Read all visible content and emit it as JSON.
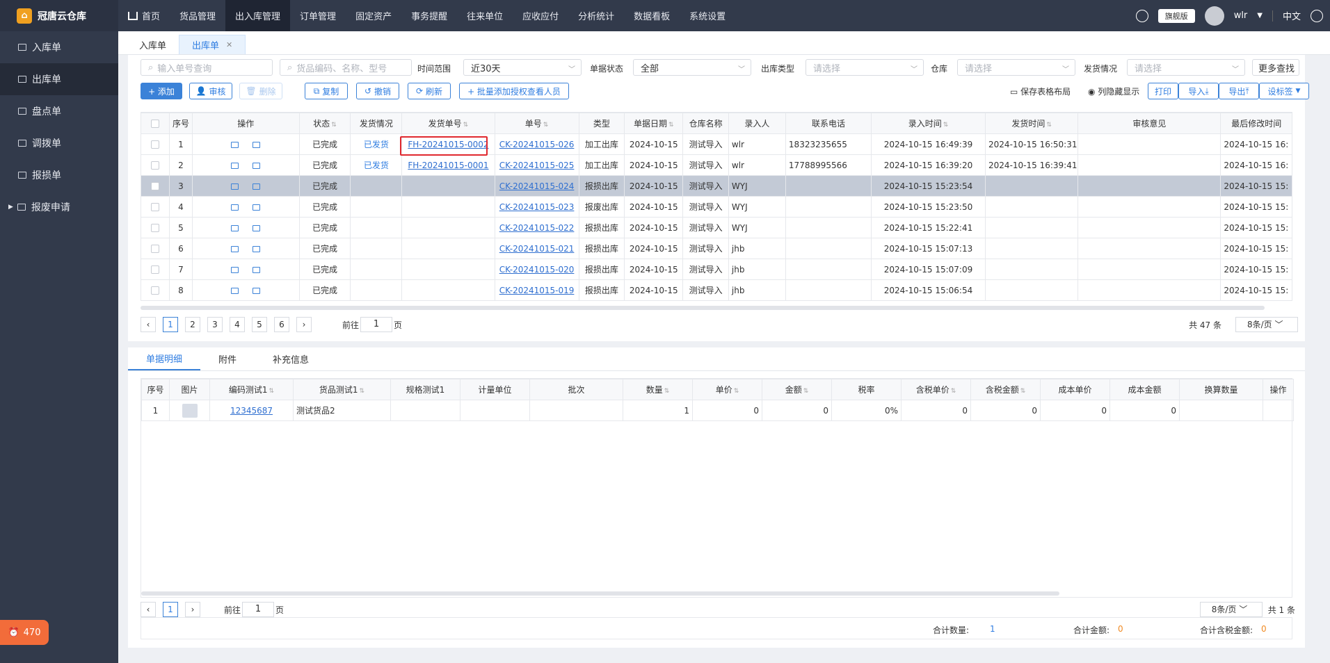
{
  "app": {
    "name": "冠唐云仓库",
    "version_badge": "旗舰版",
    "user": "wlr",
    "language": "中文"
  },
  "sidebar": {
    "items": [
      {
        "label": "入库单"
      },
      {
        "label": "出库单",
        "active": true
      },
      {
        "label": "盘点单"
      },
      {
        "label": "调拨单"
      },
      {
        "label": "报损单"
      },
      {
        "label": "报废申请"
      }
    ],
    "alert_count": "470"
  },
  "topnav": {
    "items": [
      "首页",
      "货品管理",
      "出入库管理",
      "订单管理",
      "固定资产",
      "事务提醒",
      "往来单位",
      "应收应付",
      "分析统计",
      "数据看板",
      "系统设置"
    ]
  },
  "tabs": {
    "items": [
      "入库单",
      "出库单"
    ]
  },
  "filters": {
    "order_no_placeholder": "输入单号查询",
    "goods_placeholder": "货品编码、名称、型号",
    "time_range_label": "时间范围",
    "time_range_value": "近30天",
    "status_label": "单据状态",
    "status_value": "全部",
    "out_type_label": "出库类型",
    "out_type_placeholder": "请选择",
    "warehouse_label": "仓库",
    "warehouse_placeholder": "请选择",
    "ship_label": "发货情况",
    "ship_placeholder": "请选择",
    "more": "更多查找"
  },
  "toolbar": {
    "add": "+ 添加",
    "audit": "审核",
    "delete": "删除",
    "copy": "复制",
    "revoke": "撤销",
    "refresh": "刷新",
    "batch_auth": "+ 批量添加授权查看人员",
    "save_layout": "保存表格布局",
    "column_toggle": "列隐藏显示",
    "print": "打印",
    "import": "导入",
    "export": "导出",
    "set_tag": "设标签"
  },
  "table": {
    "headers": [
      "序号",
      "操作",
      "状态",
      "发货情况",
      "发货单号",
      "单号",
      "类型",
      "单据日期",
      "仓库名称",
      "录入人",
      "联系电话",
      "录入时间",
      "发货时间",
      "审核意见",
      "最后修改时间"
    ],
    "rows": [
      {
        "seq": "1",
        "status": "已完成",
        "ship": "已发货",
        "ship_no": "FH-20241015-0002",
        "no": "CK-20241015-026",
        "type": "加工出库",
        "date": "2024-10-15",
        "wh": "测试导入",
        "user": "wlr",
        "phone": "18323235655",
        "in_time": "2024-10-15 16:49:39",
        "ship_time": "2024-10-15 16:50:31",
        "remark": "",
        "mod": "2024-10-15 16:"
      },
      {
        "seq": "2",
        "status": "已完成",
        "ship": "已发货",
        "ship_no": "FH-20241015-0001",
        "no": "CK-20241015-025",
        "type": "加工出库",
        "date": "2024-10-15",
        "wh": "测试导入",
        "user": "wlr",
        "phone": "17788995566",
        "in_time": "2024-10-15 16:39:20",
        "ship_time": "2024-10-15 16:39:41",
        "remark": "",
        "mod": "2024-10-15 16:"
      },
      {
        "seq": "3",
        "status": "已完成",
        "ship": "",
        "ship_no": "",
        "no": "CK-20241015-024",
        "type": "报损出库",
        "date": "2024-10-15",
        "wh": "测试导入",
        "user": "WYJ",
        "phone": "",
        "in_time": "2024-10-15 15:23:54",
        "ship_time": "",
        "remark": "",
        "mod": "2024-10-15 15:"
      },
      {
        "seq": "4",
        "status": "已完成",
        "ship": "",
        "ship_no": "",
        "no": "CK-20241015-023",
        "type": "报废出库",
        "date": "2024-10-15",
        "wh": "测试导入",
        "user": "WYJ",
        "phone": "",
        "in_time": "2024-10-15 15:23:50",
        "ship_time": "",
        "remark": "",
        "mod": "2024-10-15 15:"
      },
      {
        "seq": "5",
        "status": "已完成",
        "ship": "",
        "ship_no": "",
        "no": "CK-20241015-022",
        "type": "报损出库",
        "date": "2024-10-15",
        "wh": "测试导入",
        "user": "WYJ",
        "phone": "",
        "in_time": "2024-10-15 15:22:41",
        "ship_time": "",
        "remark": "",
        "mod": "2024-10-15 15:"
      },
      {
        "seq": "6",
        "status": "已完成",
        "ship": "",
        "ship_no": "",
        "no": "CK-20241015-021",
        "type": "报损出库",
        "date": "2024-10-15",
        "wh": "测试导入",
        "user": "jhb",
        "phone": "",
        "in_time": "2024-10-15 15:07:13",
        "ship_time": "",
        "remark": "",
        "mod": "2024-10-15 15:"
      },
      {
        "seq": "7",
        "status": "已完成",
        "ship": "",
        "ship_no": "",
        "no": "CK-20241015-020",
        "type": "报损出库",
        "date": "2024-10-15",
        "wh": "测试导入",
        "user": "jhb",
        "phone": "",
        "in_time": "2024-10-15 15:07:09",
        "ship_time": "",
        "remark": "",
        "mod": "2024-10-15 15:"
      },
      {
        "seq": "8",
        "status": "已完成",
        "ship": "",
        "ship_no": "",
        "no": "CK-20241015-019",
        "type": "报损出库",
        "date": "2024-10-15",
        "wh": "测试导入",
        "user": "jhb",
        "phone": "",
        "in_time": "2024-10-15 15:06:54",
        "ship_time": "",
        "remark": "",
        "mod": "2024-10-15 15:"
      }
    ]
  },
  "pager": {
    "pages": [
      "1",
      "2",
      "3",
      "4",
      "5",
      "6"
    ],
    "goto_prefix": "前往",
    "goto_value": "1",
    "goto_suffix": "页",
    "total": "共 47 条",
    "page_size": "8条/页"
  },
  "detail": {
    "tabs": [
      "单据明细",
      "附件",
      "补充信息"
    ],
    "headers": [
      "序号",
      "图片",
      "编码测试1",
      "货品测试1",
      "规格测试1",
      "计量单位",
      "批次",
      "数量",
      "单价",
      "金额",
      "税率",
      "含税单价",
      "含税金额",
      "成本单价",
      "成本金额",
      "换算数量",
      "操作"
    ],
    "rows": [
      {
        "seq": "1",
        "code": "12345687",
        "name": "测试货品2",
        "spec": "",
        "unit": "",
        "batch": "",
        "qty": "1",
        "price": "0",
        "amount": "0",
        "tax": "0%",
        "tax_price": "0",
        "tax_amount": "0",
        "cost_price": "0",
        "cost_amount": "0",
        "conv": ""
      }
    ],
    "pager": {
      "page": "1",
      "goto_prefix": "前往",
      "goto_value": "1",
      "goto_suffix": "页",
      "page_size": "8条/页",
      "total": "共 1 条"
    },
    "totals": {
      "qty_label": "合计数量:",
      "qty": "1",
      "amount_label": "合计金额:",
      "amount": "0",
      "tax_amount_label": "合计含税金额:",
      "tax_amount": "0"
    }
  }
}
